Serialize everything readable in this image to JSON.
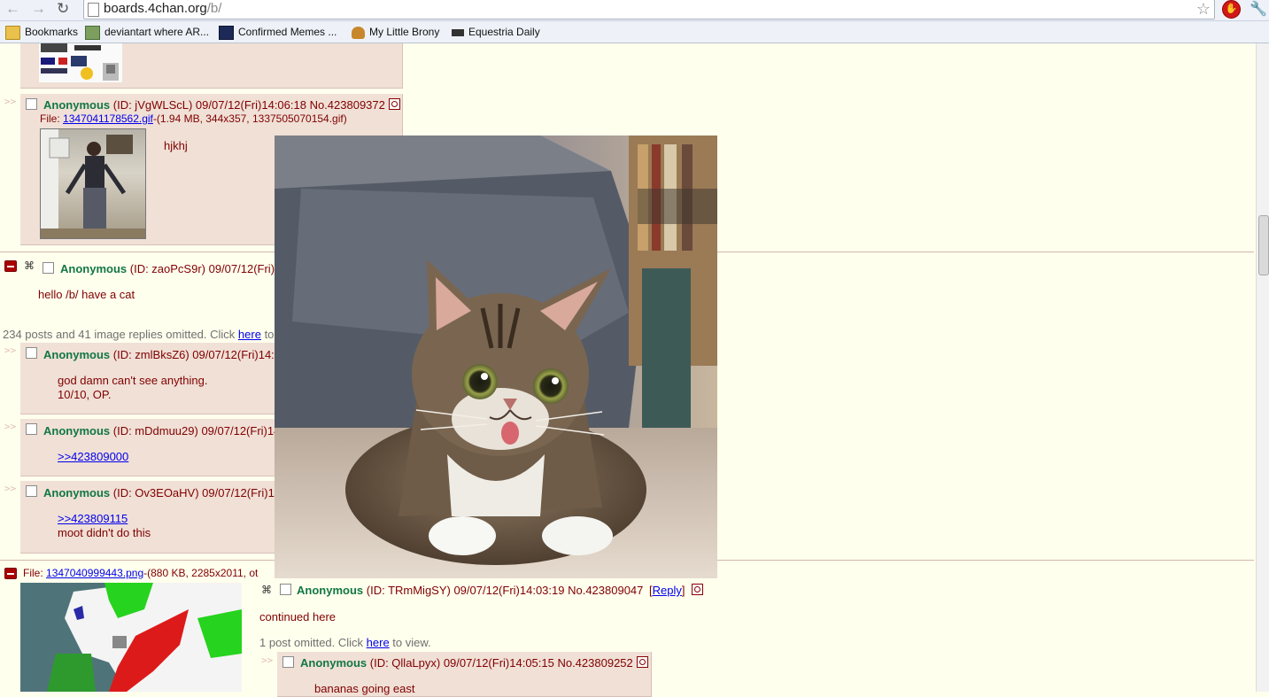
{
  "browser": {
    "url_host": "boards.4chan.org",
    "url_path": "/b/",
    "bookmarks": [
      {
        "label": "Bookmarks",
        "icon": "folder-icon"
      },
      {
        "label": "deviantart where AR...",
        "icon": "deviantart-icon"
      },
      {
        "label": "Confirmed Memes ...",
        "icon": "knowyourmeme-icon"
      },
      {
        "label": "My Little Brony",
        "icon": "burger-icon"
      },
      {
        "label": "Equestria Daily",
        "icon": "eqd-icon"
      }
    ]
  },
  "post1": {
    "name": "Anonymous",
    "meta": "(ID: jVgWLScL) 09/07/12(Fri)14:06:18 No.423809372",
    "file_prefix": "File: ",
    "file_link": "1347041178562.gif",
    "file_info": "-(1.94 MB, 344x357, 1337505070154.gif)",
    "comment": "hjkhj"
  },
  "thread1": {
    "name": "Anonymous",
    "meta": "(ID: zaoPcS9r) 09/07/12(Fri)",
    "comment": "hello /b/ have a cat",
    "omitted_text": "234 posts and 41 image replies omitted. Click ",
    "omitted_link": "here",
    "omitted_after": " to"
  },
  "reply_a": {
    "name": "Anonymous",
    "meta": "(ID: zmlBksZ6) 09/07/12(Fri)14:",
    "line1": "god damn can't see anything.",
    "line2": "10/10, OP."
  },
  "reply_b": {
    "name": "Anonymous",
    "meta": "(ID: mDdmuu29) 09/07/12(Fri)14",
    "quote": ">>423809000"
  },
  "reply_c": {
    "name": "Anonymous",
    "meta": "(ID: Ov3EOaHV) 09/07/12(Fri)14",
    "quote": ">>423809115",
    "comment": "moot didn't do this"
  },
  "thread2": {
    "file_prefix": "File: ",
    "file_link": "1347040999443.png",
    "file_info": "-(880 KB, 2285x2011, ot",
    "name": "Anonymous",
    "meta": "(ID: TRmMigSY) 09/07/12(Fri)14:03:19 No.423809047",
    "reply_link": "Reply",
    "reply_open": "[",
    "reply_close": "]",
    "comment": "continued here",
    "omitted_text": "1 post omitted. Click ",
    "omitted_link": "here",
    "omitted_after": " to view."
  },
  "reply_d": {
    "name": "Anonymous",
    "meta": "(ID: QllaLpyx) 09/07/12(Fri)14:05:15 No.423809252",
    "comment": "bananas going east"
  },
  "colors": {
    "board_bg": "#ffffee",
    "reply_bg": "#f0e0d6",
    "name_green": "#117743",
    "text_maroon": "#800000",
    "link_blue": "#0000ee"
  }
}
